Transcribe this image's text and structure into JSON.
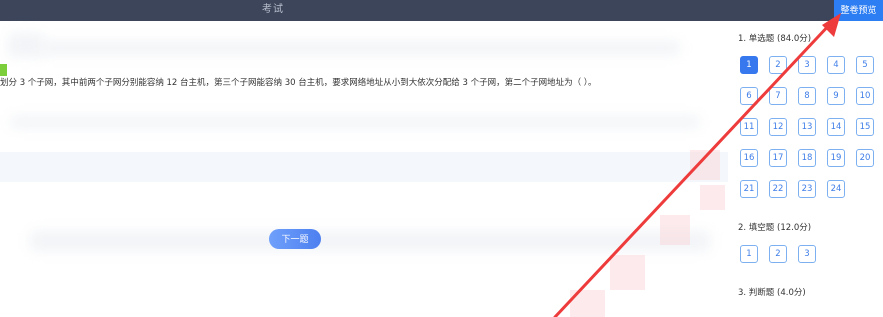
{
  "header": {
    "title": "考试",
    "preview_button": "整卷预览"
  },
  "question": {
    "text": "划分 3 个子网，其中前两个子网分别能容纳 12 台主机，第三个子网能容纳 30 台主机，要求网络地址从小到大依次分配给 3 个子网，第二个子网地址为（  ）。",
    "next_button": "下一题"
  },
  "answer_card": {
    "sections": [
      {
        "title": "1. 单选题  (84.0分)",
        "numbers": [
          "1",
          "2",
          "3",
          "4",
          "5",
          "6",
          "7",
          "8",
          "9",
          "10",
          "11",
          "12",
          "13",
          "14",
          "15",
          "16",
          "17",
          "18",
          "19",
          "20",
          "21",
          "22",
          "23",
          "24"
        ],
        "active": "1"
      },
      {
        "title": "2. 填空题  (12.0分)",
        "numbers": [
          "1",
          "2",
          "3"
        ]
      },
      {
        "title": "3. 判断题  (4.0分)",
        "numbers": []
      }
    ]
  },
  "colors": {
    "topbar": "#3c4559",
    "accent": "#2d7ef2",
    "active_button": "#3778ee",
    "arrow": "#ee3b3b"
  }
}
